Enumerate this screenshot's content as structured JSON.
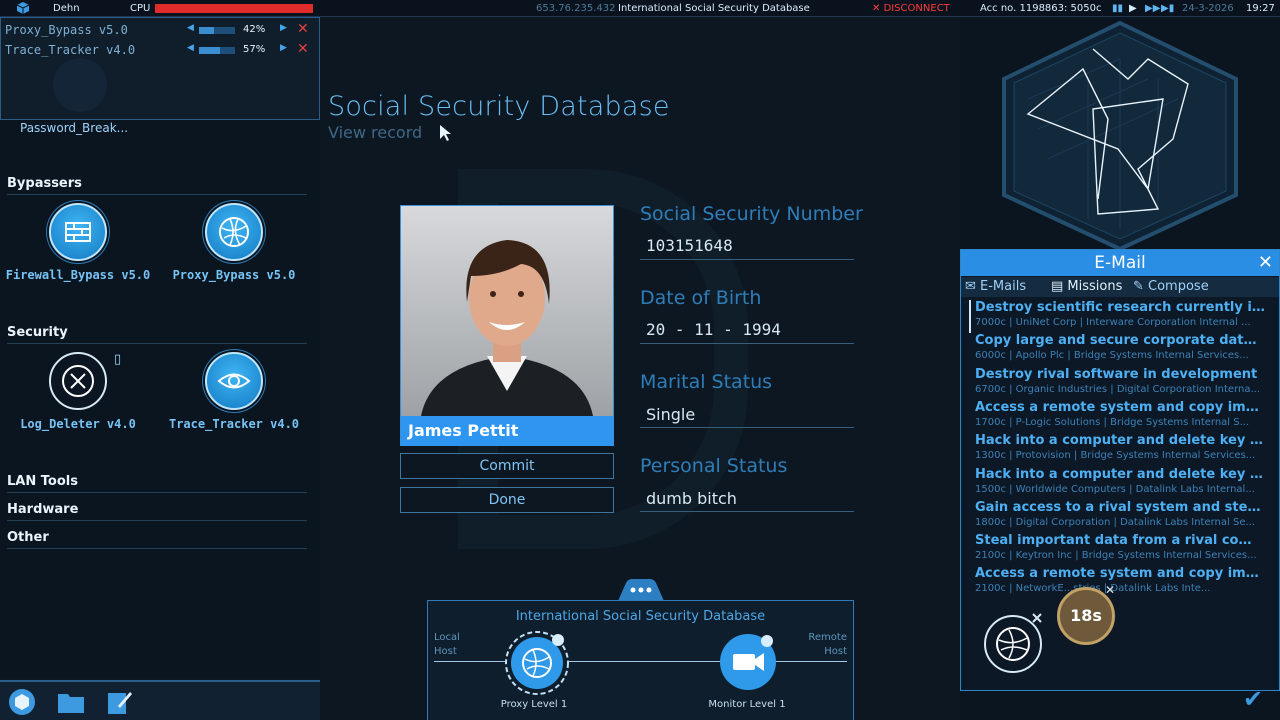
{
  "topbar": {
    "user": "Dehn",
    "cpu_label": "CPU",
    "ip": "653.76.235.432",
    "site": "International Social Security Database",
    "disconnect": "DISCONNECT",
    "account": "Acc no. 1198863: 5050c",
    "date": "24-3-2026",
    "time": "19:27"
  },
  "running": [
    {
      "name": "Proxy_Bypass v5.0",
      "percent": "42%",
      "progress": 0.42
    },
    {
      "name": "Trace_Tracker v4.0",
      "percent": "57%",
      "progress": 0.57
    }
  ],
  "left": {
    "password_label": "Password_Break...",
    "sections": {
      "bypassers": "Bypassers",
      "security": "Security",
      "lan": "LAN Tools",
      "hardware": "Hardware",
      "other": "Other"
    },
    "tools": {
      "firewall": "Firewall_Bypass v5.0",
      "proxy": "Proxy_Bypass v5.0",
      "log": "Log_Deleter v4.0",
      "trace": "Trace_Tracker v4.0"
    }
  },
  "record": {
    "title": "Social Security Database",
    "subtitle": "View record",
    "person_name": "James Pettit",
    "commit": "Commit",
    "done": "Done",
    "fields": [
      {
        "label": "Social Security Number",
        "value": "103151648"
      },
      {
        "label": "Date of Birth",
        "value": "20 - 11 - 1994"
      },
      {
        "label": "Marital Status",
        "value": "Single"
      },
      {
        "label": "Personal Status",
        "value": "dumb bitch"
      }
    ]
  },
  "network": {
    "title": "International Social Security Database",
    "local": "Local",
    "local2": "Host",
    "remote": "Remote",
    "remote2": "Host",
    "node1": "Proxy Level 1",
    "node2": "Monitor Level 1"
  },
  "email": {
    "title": "E-Mail",
    "tab_emails": "E-Mails",
    "tab_missions": "Missions",
    "tab_compose": "Compose",
    "timer": "18s",
    "missions": [
      {
        "title": "Destroy scientific research currently in pr...",
        "sub": "7000c | UniNet Corp | Interware Corporation Internal ..."
      },
      {
        "title": "Copy large and secure corporate database",
        "sub": "6000c | Apollo Plc | Bridge Systems Internal Services..."
      },
      {
        "title": "Destroy rival software in development",
        "sub": "6700c | Organic Industries | Digital Corporation Interna..."
      },
      {
        "title": "Access a remote system and copy import...",
        "sub": "1700c | P-Logic Solutions | Bridge Systems Internal S..."
      },
      {
        "title": "Hack into a computer and delete key files",
        "sub": "1300c | Protovision | Bridge Systems Internal Services..."
      },
      {
        "title": "Hack into a computer and delete key files",
        "sub": "1500c | Worldwide Computers | Datalink Labs Internal..."
      },
      {
        "title": "Gain access to a rival system and steal re...",
        "sub": "1800c | Digital Corporation | Datalink Labs Internal Se..."
      },
      {
        "title": "Steal important data from a rival company...",
        "sub": "2100c | Keytron Inc | Bridge Systems Internal Services..."
      },
      {
        "title": "Access a remote system and copy import...",
        "sub": "2100c | NetworkE...stries | Datalink Labs Inte..."
      }
    ]
  }
}
